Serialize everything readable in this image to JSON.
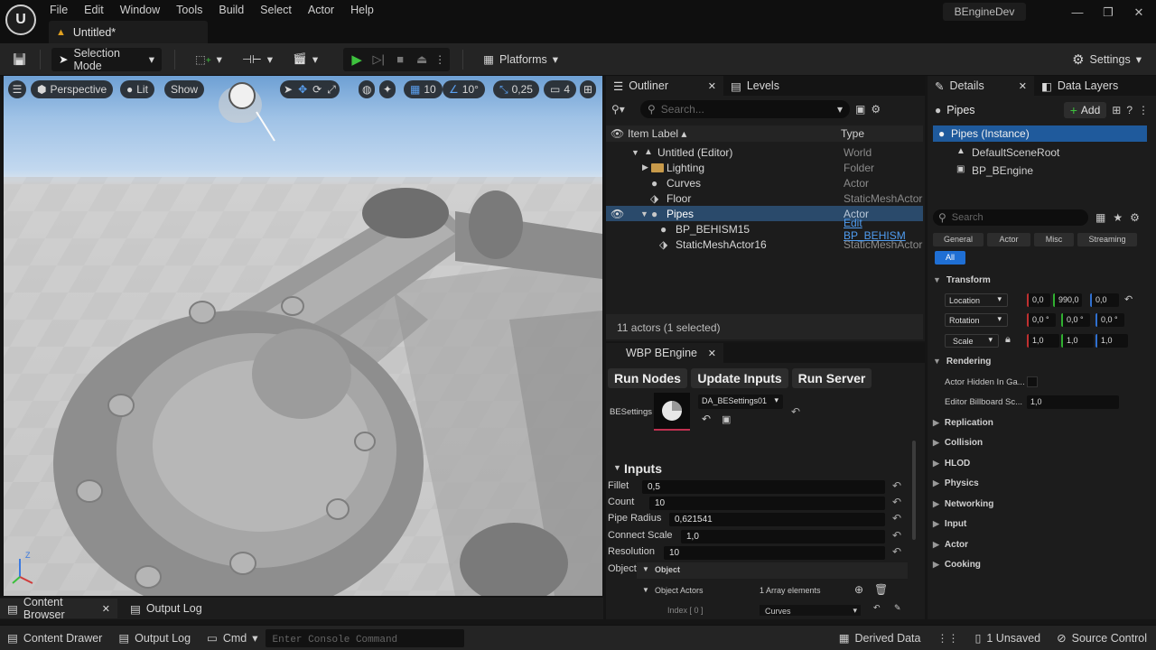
{
  "app": {
    "logo": "U",
    "title": "BEngineDev",
    "doc_tab": "Untitled*"
  },
  "menu": [
    "File",
    "Edit",
    "Window",
    "Tools",
    "Build",
    "Select",
    "Actor",
    "Help"
  ],
  "window_controls": {
    "minimize": "—",
    "restore": "❐",
    "close": "✕"
  },
  "toolbar": {
    "selection_mode": "Selection Mode",
    "platforms": "Platforms",
    "settings": "Settings"
  },
  "viewport": {
    "perspective": "Perspective",
    "lit": "Lit",
    "show": "Show",
    "grid_snap": "10",
    "rot_snap": "10°",
    "scale_snap": "0,25",
    "camera_speed": "4",
    "axis_z": "Z"
  },
  "outliner": {
    "tab": "Outliner",
    "levels_tab": "Levels",
    "search_placeholder": "Search...",
    "col_label": "Item Label ▴",
    "col_type": "Type",
    "rows": [
      {
        "label": "Untitled (Editor)",
        "type": "World"
      },
      {
        "label": "Lighting",
        "type": "Folder"
      },
      {
        "label": "Curves",
        "type": "Actor"
      },
      {
        "label": "Floor",
        "type": "StaticMeshActor"
      },
      {
        "label": "Pipes",
        "type": "Actor"
      },
      {
        "label": "BP_BEHISM15",
        "type": "Edit BP_BEHISM"
      },
      {
        "label": "StaticMeshActor16",
        "type": "StaticMeshActor"
      }
    ],
    "footer": "11 actors (1 selected)"
  },
  "wbp": {
    "tab": "WBP BEngine",
    "buttons": [
      "Run Nodes",
      "Update Inputs",
      "Run Server"
    ],
    "settings_label": "BESettings",
    "settings_asset": "DA_BESettings01",
    "inputs_title": "Inputs",
    "inputs": [
      {
        "key": "Fillet",
        "value": "0,5"
      },
      {
        "key": "Count",
        "value": "10"
      },
      {
        "key": "Pipe Radius",
        "value": "0,621541"
      },
      {
        "key": "Connect Scale",
        "value": "1,0"
      },
      {
        "key": "Resolution",
        "value": "10"
      }
    ],
    "object_key": "Object",
    "object_group": "Object",
    "object_actors": "Object Actors",
    "array_elements": "1 Array elements",
    "index_label": "Index [ 0 ]",
    "index_value": "Curves"
  },
  "details": {
    "tab": "Details",
    "data_layers_tab": "Data Layers",
    "actor_name": "Pipes",
    "add_button": "Add",
    "components": [
      "Pipes (Instance)",
      "DefaultSceneRoot",
      "BP_BEngine"
    ],
    "search_placeholder": "Search",
    "filters": [
      "General",
      "Actor",
      "Misc",
      "Streaming",
      "All"
    ],
    "transform": "Transform",
    "location": {
      "label": "Location",
      "x": "0,0",
      "y": "990,0",
      "z": "0,0"
    },
    "rotation": {
      "label": "Rotation",
      "x": "0,0 °",
      "y": "0,0 °",
      "z": "0,0 °"
    },
    "scale": {
      "label": "Scale",
      "x": "1,0",
      "y": "1,0",
      "z": "1,0"
    },
    "rendering": "Rendering",
    "actor_hidden": "Actor Hidden In Ga...",
    "billboard": "Editor Billboard Sc...",
    "billboard_value": "1,0",
    "categories": [
      "Replication",
      "Collision",
      "HLOD",
      "Physics",
      "Networking",
      "Input",
      "Actor",
      "Cooking"
    ]
  },
  "bottom_tabs": [
    "Content Browser",
    "Output Log"
  ],
  "status": {
    "content_drawer": "Content Drawer",
    "output_log": "Output Log",
    "cmd": "Cmd",
    "console_placeholder": "Enter Console Command",
    "derived_data": "Derived Data",
    "unsaved": "1 Unsaved",
    "source_control": "Source Control"
  },
  "colors": {
    "accent_blue": "#1f5a9c",
    "selected_row": "#2a4a6b",
    "play_green": "#3ec23e",
    "link_blue": "#4f9cf0"
  }
}
